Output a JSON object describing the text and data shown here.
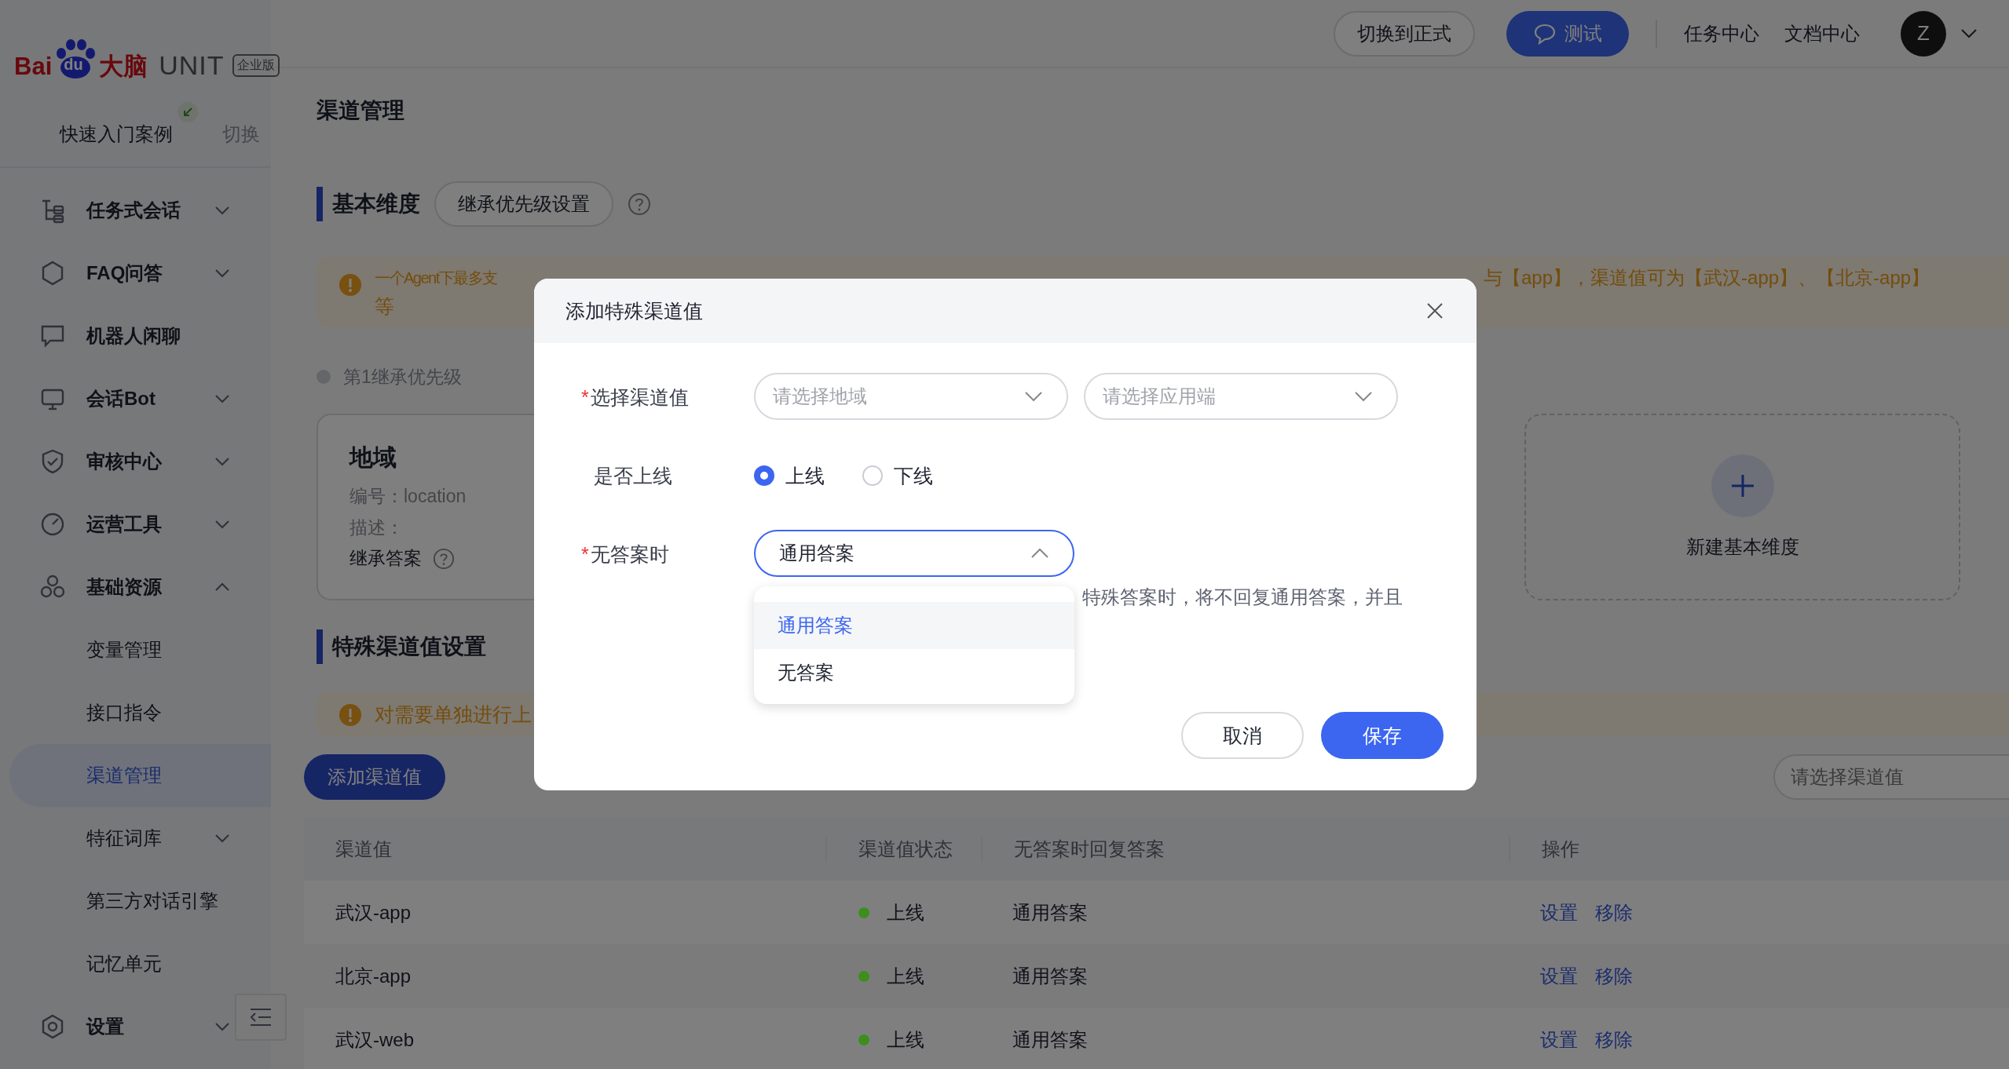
{
  "logo": {
    "brand": "Bai",
    "paw_text": "du",
    "name_cn": "大脑",
    "product": "UNIT",
    "edition": "企业版"
  },
  "quick_start": {
    "label": "快速入门案例",
    "switch": "切换"
  },
  "sidebar": {
    "items": [
      {
        "label": "任务式会话",
        "selected": false,
        "expanded": false
      },
      {
        "label": "FAQ问答",
        "selected": false,
        "expanded": false
      },
      {
        "label": "机器人闲聊",
        "selected": false
      },
      {
        "label": "会话Bot",
        "selected": false,
        "expanded": false
      },
      {
        "label": "审核中心",
        "selected": false,
        "expanded": false
      },
      {
        "label": "运营工具",
        "selected": false,
        "expanded": false
      },
      {
        "label": "基础资源",
        "selected": false,
        "expanded": true,
        "children": [
          {
            "label": "变量管理",
            "selected": false
          },
          {
            "label": "接口指令",
            "selected": false
          },
          {
            "label": "渠道管理",
            "selected": true
          },
          {
            "label": "特征词库",
            "selected": false,
            "expanded": false
          },
          {
            "label": "第三方对话引擎",
            "selected": false
          },
          {
            "label": "记忆单元",
            "selected": false
          }
        ]
      },
      {
        "label": "设置",
        "selected": false,
        "expanded": false
      }
    ]
  },
  "header": {
    "buttons": [
      {
        "label": "切换到正式",
        "kind": "outline"
      },
      {
        "label": "测试",
        "kind": "primary"
      }
    ],
    "links": [
      "任务中心",
      "文档中心"
    ],
    "avatar": "Z"
  },
  "page_title": "渠道管理",
  "basic": {
    "title": "基本维度",
    "button": "继承优先级设置",
    "alert_parts": [
      "一个Agent下最多支",
      "与【app】，渠道值可为【武汉-app】、【北京-app】",
      "等"
    ],
    "priority": "第1继承优先级",
    "card": {
      "name": "地域",
      "fields": [
        "编号：location",
        "描述："
      ],
      "inherit": "继承答案"
    },
    "new_card": "新建基本维度"
  },
  "special": {
    "title": "特殊渠道值设置",
    "alert": "对需要单独进行上",
    "add_button": "添加渠道值",
    "search": {
      "placeholder": "请选择渠道值"
    },
    "table": {
      "columns": [
        "渠道值",
        "渠道值状态",
        "无答案时回复答案",
        "操作"
      ],
      "rows": [
        {
          "channel": "武汉-app",
          "status": "上线",
          "color": "#3e8e1e",
          "answer": "通用答案",
          "actions": [
            "设置",
            "移除"
          ]
        },
        {
          "channel": "北京-app",
          "status": "上线",
          "color": "#3e8e1e",
          "answer": "通用答案",
          "actions": [
            "设置",
            "移除"
          ]
        },
        {
          "channel": "武汉-web",
          "status": "上线",
          "color": "#3e8e1e",
          "answer": "通用答案",
          "actions": [
            "设置",
            "移除"
          ]
        }
      ]
    }
  },
  "dialog": {
    "title": "添加特殊渠道值",
    "fields": [
      {
        "kind": "selects",
        "label": "选择渠道值",
        "required_mark": "*",
        "selects": [
          {
            "placeholder": "请选择地域"
          },
          {
            "placeholder": "请选择应用端"
          }
        ]
      },
      {
        "kind": "radio",
        "label": "是否上线",
        "options": [
          {
            "label": "上线",
            "selected": true
          },
          {
            "label": "下线",
            "selected": false
          }
        ]
      },
      {
        "kind": "select",
        "label": "无答案时",
        "required_mark": "*",
        "value": "通用答案",
        "expanded": true,
        "hint": "特殊答案时，将不回复通用答案，并且",
        "options": [
          {
            "label": "通用答案",
            "selected": true
          },
          {
            "label": "无答案",
            "selected": false
          }
        ]
      }
    ],
    "buttons": [
      {
        "label": "取消",
        "kind": "default"
      },
      {
        "label": "保存",
        "kind": "primary"
      }
    ]
  }
}
